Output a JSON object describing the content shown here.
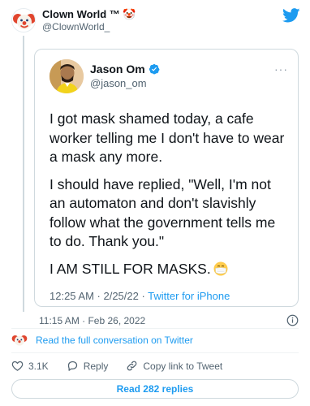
{
  "header": {
    "author_name": "Clown World ™ 🤡",
    "author_handle": "@ClownWorld_",
    "brand_color": "#1d9bf0",
    "icons": [
      "clown-avatar",
      "twitter-bird-icon"
    ]
  },
  "quoted_tweet": {
    "name": "Jason Om",
    "handle": "@jason_om",
    "verified": true,
    "more_label": "···",
    "paragraphs": [
      "I got mask shamed today, a cafe worker telling me I don't have to wear a mask any more.",
      "I should have replied, \"Well, I'm not an automaton and don't slavishly follow what the government tells me to do. Thank you.\"",
      "I AM STILL FOR MASKS."
    ],
    "meta_time": "12:25 AM · 2/25/22 · ",
    "meta_source": "Twitter for iPhone"
  },
  "timestamp": "11:15 AM · Feb 26, 2022",
  "conversation_link": "Read the full conversation on Twitter",
  "actions": {
    "likes": "3.1K",
    "reply_label": "Reply",
    "copy_label": "Copy link to Tweet"
  },
  "read_replies_label": "Read 282 replies"
}
